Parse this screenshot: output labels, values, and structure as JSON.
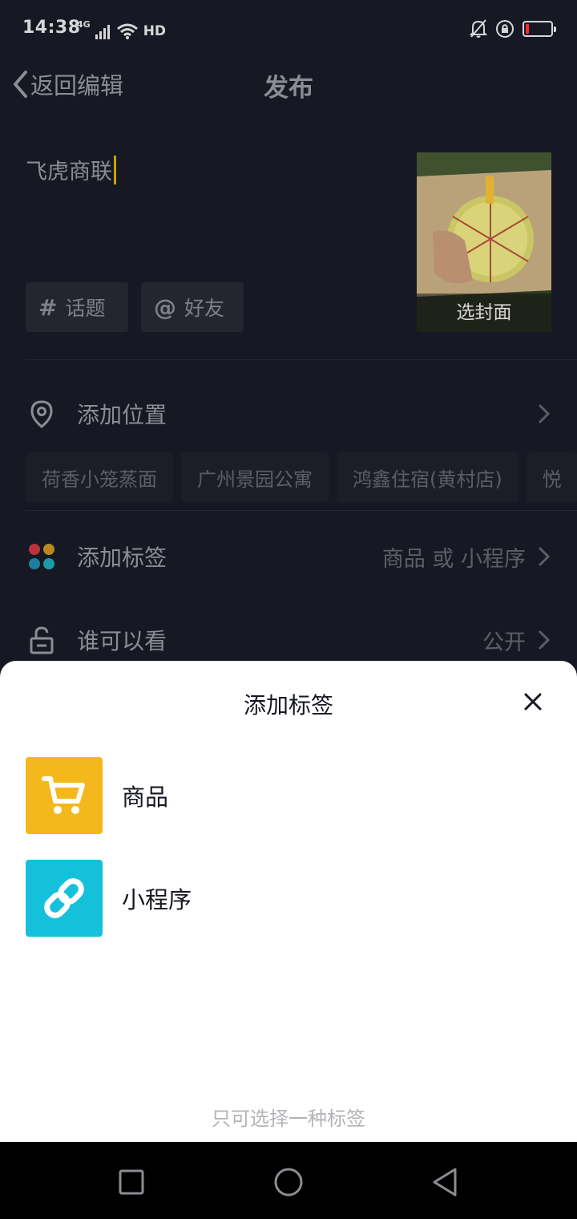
{
  "status_bar": {
    "time": "14:38",
    "network": "4G",
    "hd": "HD"
  },
  "header": {
    "back_label": "返回编辑",
    "title": "发布"
  },
  "post": {
    "caption": "飞虎商联",
    "cover_label": "选封面",
    "topic_chip": "话题",
    "friend_chip": "好友"
  },
  "location": {
    "label": "添加位置",
    "suggestions": [
      "荷香小笼蒸面",
      "广州景园公寓",
      "鸿鑫住宿(黄村店)",
      "悦"
    ]
  },
  "tags_row": {
    "label": "添加标签",
    "value": "商品 或 小程序"
  },
  "visibility_row": {
    "label": "谁可以看",
    "value": "公开"
  },
  "sheet": {
    "title": "添加标签",
    "options": [
      {
        "label": "商品",
        "icon": "cart-icon",
        "color": "#f4b81d"
      },
      {
        "label": "小程序",
        "icon": "mini-program-icon",
        "color": "#15c1da"
      }
    ],
    "hint": "只可选择一种标签"
  },
  "colors": {
    "background": "#161823",
    "sheet": "#ffffff",
    "cursor": "#c9a200",
    "battery_low": "#ff2a2a"
  }
}
